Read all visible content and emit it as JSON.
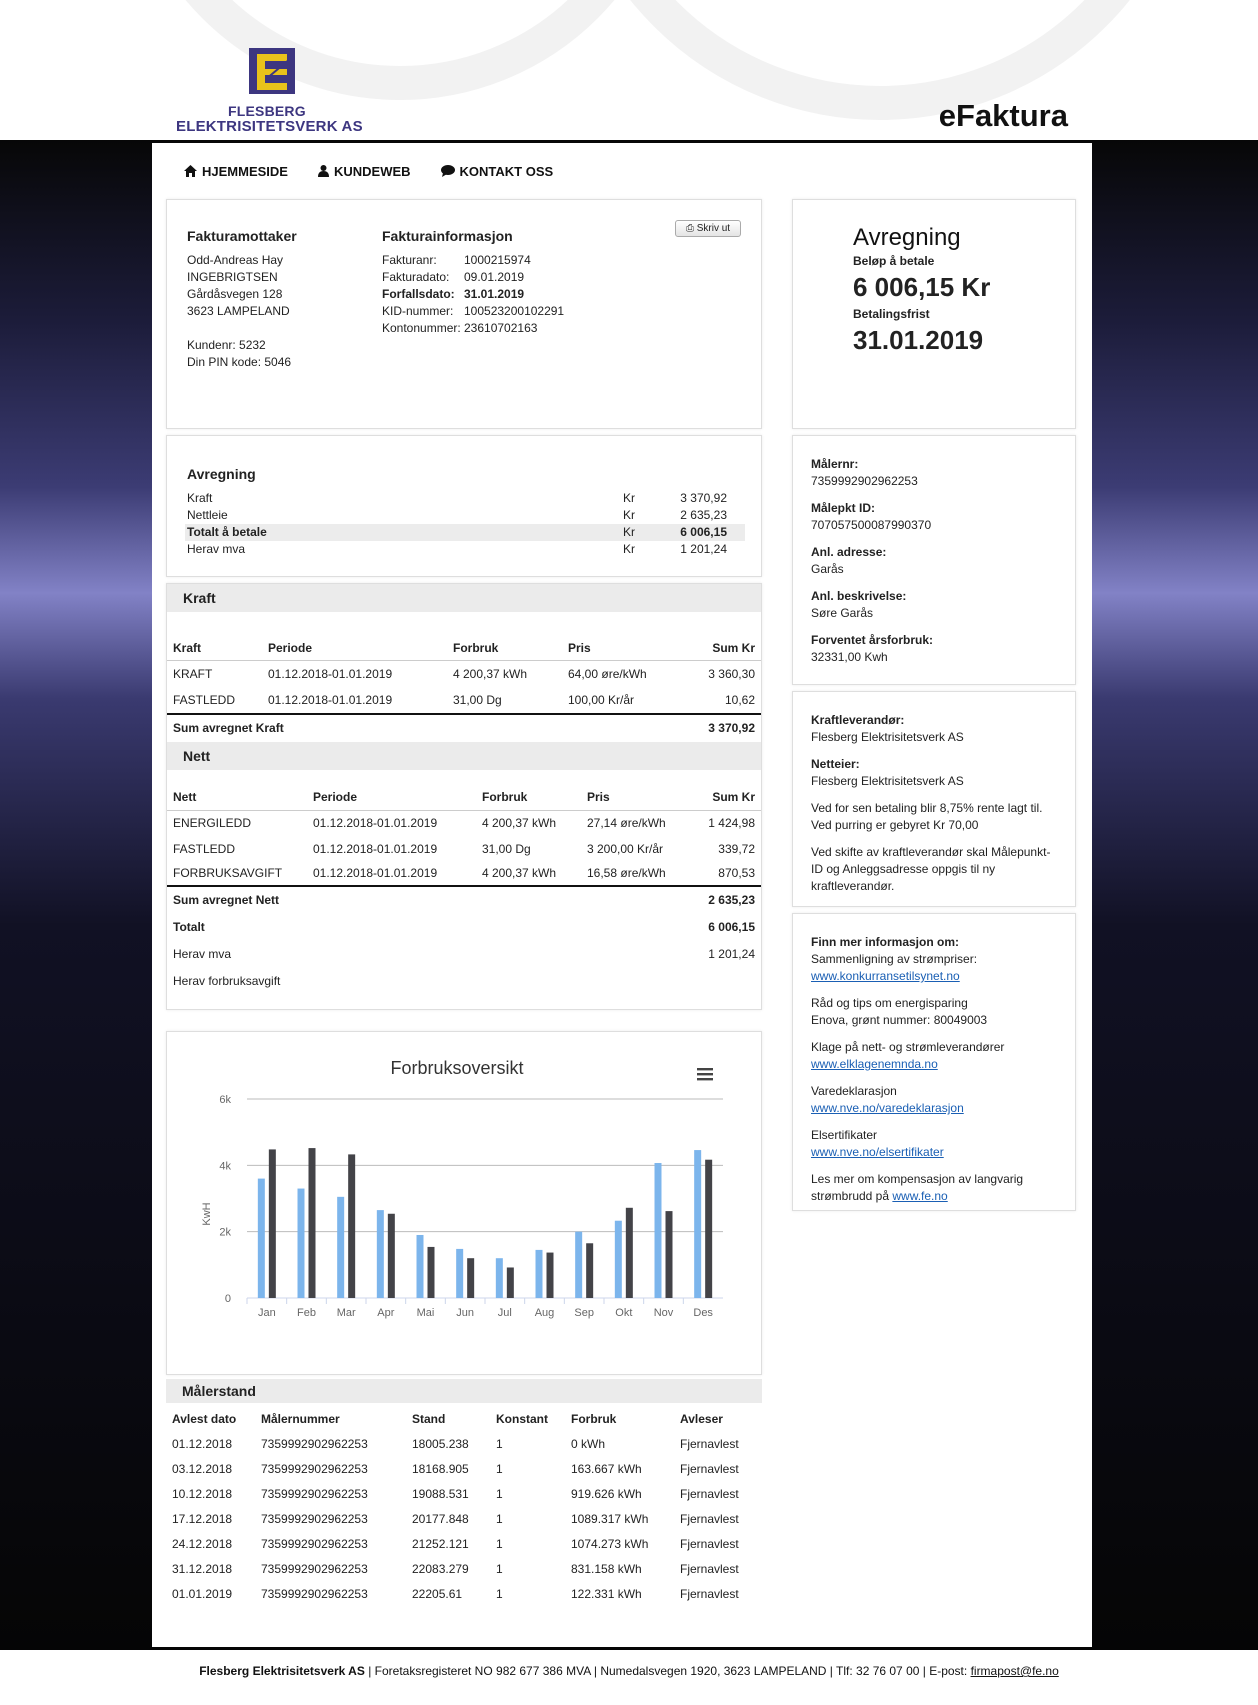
{
  "brand": {
    "logo_line1": "FLESBERG",
    "logo_line2": "ELEKTRISITETSVERK AS",
    "title": "eFaktura"
  },
  "nav": [
    {
      "label": "HJEMMESIDE",
      "icon": "home-icon"
    },
    {
      "label": "KUNDEWEB",
      "icon": "user-icon"
    },
    {
      "label": "KONTAKT OSS",
      "icon": "comment-icon"
    }
  ],
  "recipient": {
    "heading": "Fakturamottaker",
    "lines": [
      "Odd-Andreas Hay",
      "INGEBRIGTSEN",
      "Gårdåsvegen 128",
      "3623  LAMPELAND"
    ],
    "customer": "Kundenr: 5232",
    "pin": "Din PIN kode: 5046"
  },
  "invoice_info": {
    "heading": "Fakturainformasjon",
    "print_label": "Skriv ut",
    "rows": [
      {
        "label": "Fakturanr:",
        "value": "1000215974"
      },
      {
        "label": "Fakturadato:",
        "value": "09.01.2019"
      },
      {
        "label": "Forfallsdato:",
        "value": "31.01.2019"
      },
      {
        "label": "KID-nummer:",
        "value": "100523200102291"
      },
      {
        "label": "Kontonummer:",
        "value": "23610702163"
      }
    ]
  },
  "summary_box": {
    "heading": "Avregning",
    "amount_label": "Beløp å betale",
    "amount": "6 006,15 Kr",
    "due_label": "Betalingsfrist",
    "due": "31.01.2019"
  },
  "settlement": {
    "heading": "Avregning",
    "rows": [
      {
        "label": "Kraft",
        "cur": "Kr",
        "value": "3 370,92"
      },
      {
        "label": "Nettleie",
        "cur": "Kr",
        "value": "2 635,23"
      },
      {
        "label": "Totalt å betale",
        "cur": "Kr",
        "value": "6 006,15"
      },
      {
        "label": "Herav mva",
        "cur": "Kr",
        "value": "1 201,24"
      }
    ]
  },
  "kraft": {
    "section": "Kraft",
    "headers": [
      "Kraft",
      "Periode",
      "Forbruk",
      "Pris",
      "Sum Kr"
    ],
    "rows": [
      [
        "KRAFT",
        "01.12.2018-01.01.2019",
        "4 200,37 kWh",
        "64,00 øre/kWh",
        "3 360,30"
      ],
      [
        "FASTLEDD",
        "01.12.2018-01.01.2019",
        "31,00 Dg",
        "100,00 Kr/år",
        "10,62"
      ]
    ],
    "sum_label": "Sum avregnet  Kraft",
    "sum_value": "3 370,92"
  },
  "nett": {
    "section": "Nett",
    "headers": [
      "Nett",
      "Periode",
      "Forbruk",
      "Pris",
      "Sum Kr"
    ],
    "rows": [
      [
        "ENERGILEDD",
        "01.12.2018-01.01.2019",
        "4 200,37 kWh",
        "27,14 øre/kWh",
        "1 424,98"
      ],
      [
        "FASTLEDD",
        "01.12.2018-01.01.2019",
        "31,00 Dg",
        "3 200,00 Kr/år",
        "339,72"
      ],
      [
        "FORBRUKSAVGIFT",
        "01.12.2018-01.01.2019",
        "4 200,37 kWh",
        "16,58 øre/kWh",
        "870,53"
      ]
    ],
    "sum_label": "Sum avregnet  Nett",
    "sum_value": "2 635,23",
    "total_label": "Totalt",
    "total_value": "6 006,15",
    "mva_label": "Herav mva",
    "mva_value": "1 201,24",
    "avgift_label": "Herav forbruksavgift"
  },
  "meter_info": [
    {
      "label": "Målernr:",
      "value": "7359992902962253"
    },
    {
      "label": "Målepkt ID:",
      "value": "707057500087990370"
    },
    {
      "label": "Anl. adresse:",
      "value": "Garås"
    },
    {
      "label": "Anl. beskrivelse:",
      "value": "Søre Garås"
    },
    {
      "label": "Forventet årsforbruk:",
      "value": "32331,00 Kwh"
    }
  ],
  "supplier": {
    "supplier_label": "Kraftleverandør:",
    "supplier_value": "Flesberg Elektrisitetsverk AS",
    "owner_label": "Netteier:",
    "owner_value": "Flesberg Elektrisitetsverk AS",
    "note1": [
      "Ved for sen betaling blir 8,75% rente lagt til.",
      "Ved purring er gebyret Kr 70,00"
    ],
    "note2": [
      "Ved skifte av kraftleverandør skal Målepunkt-",
      "ID og Anleggsadresse oppgis til ny",
      "kraftleverandør."
    ]
  },
  "info": {
    "heading": "Finn mer informasjon om:",
    "blocks": [
      {
        "text": "Sammenligning av strømpriser:",
        "link": "www.konkurransetilsynet.no"
      },
      {
        "text": "Råd og tips om energisparing",
        "text2": "Enova, grønt nummer: 80049003"
      },
      {
        "text": "Klage på nett- og strømleverandører",
        "link": "www.elklagenemnda.no"
      },
      {
        "text": "Varedeklarasjon",
        "link": "www.nve.no/varedeklarasjon"
      },
      {
        "text": "Elsertifikater",
        "link": "www.nve.no/elsertifikater"
      },
      {
        "text": "Les mer om kompensasjon av langvarig",
        "text2": "strømbrudd på",
        "link2": "www.fe.no"
      }
    ]
  },
  "chart_data": {
    "type": "bar",
    "title": "Forbruksoversikt",
    "ylabel": "KwH",
    "xlabel": "",
    "categories": [
      "Jan",
      "Feb",
      "Mar",
      "Apr",
      "Mai",
      "Jun",
      "Jul",
      "Aug",
      "Sep",
      "Okt",
      "Nov",
      "Des"
    ],
    "ylim": [
      0,
      6000
    ],
    "yticks": [
      "0",
      "2k",
      "4k",
      "6k"
    ],
    "yticks_values": [
      0,
      2000,
      4000,
      6000
    ],
    "series": [
      {
        "values": [
          3600,
          3300,
          3050,
          2650,
          1900,
          1480,
          1200,
          1450,
          2000,
          2330,
          4070,
          4460
        ],
        "color": "#7cb5ec"
      },
      {
        "values": [
          4480,
          4520,
          4330,
          2540,
          1540,
          1200,
          920,
          1370,
          1650,
          2720,
          2620,
          4170
        ],
        "color": "#434348"
      }
    ],
    "grid": true,
    "legend": "none"
  },
  "readings": {
    "section": "Målerstand",
    "headers": [
      "Avlest dato",
      "Målernummer",
      "Stand",
      "Konstant",
      "Forbruk",
      "Avleser"
    ],
    "rows": [
      [
        "01.12.2018",
        "7359992902962253",
        "18005.238",
        "1",
        "0 kWh",
        "Fjernavlest"
      ],
      [
        "03.12.2018",
        "7359992902962253",
        "18168.905",
        "1",
        "163.667 kWh",
        "Fjernavlest"
      ],
      [
        "10.12.2018",
        "7359992902962253",
        "19088.531",
        "1",
        "919.626 kWh",
        "Fjernavlest"
      ],
      [
        "17.12.2018",
        "7359992902962253",
        "20177.848",
        "1",
        "1089.317 kWh",
        "Fjernavlest"
      ],
      [
        "24.12.2018",
        "7359992902962253",
        "21252.121",
        "1",
        "1074.273 kWh",
        "Fjernavlest"
      ],
      [
        "31.12.2018",
        "7359992902962253",
        "22083.279",
        "1",
        "831.158 kWh",
        "Fjernavlest"
      ],
      [
        "01.01.2019",
        "7359992902962253",
        "22205.61",
        "1",
        "122.331 kWh",
        "Fjernavlest"
      ]
    ]
  },
  "footer": {
    "company": "Flesberg Elektrisitetsverk AS",
    "text": " | Foretaksregisteret NO 982 677 386 MVA | Numedalsvegen 1920, 3623 LAMPELAND | Tlf: 32 76 07 00 | E-post: ",
    "email": "firmapost@fe.no"
  }
}
